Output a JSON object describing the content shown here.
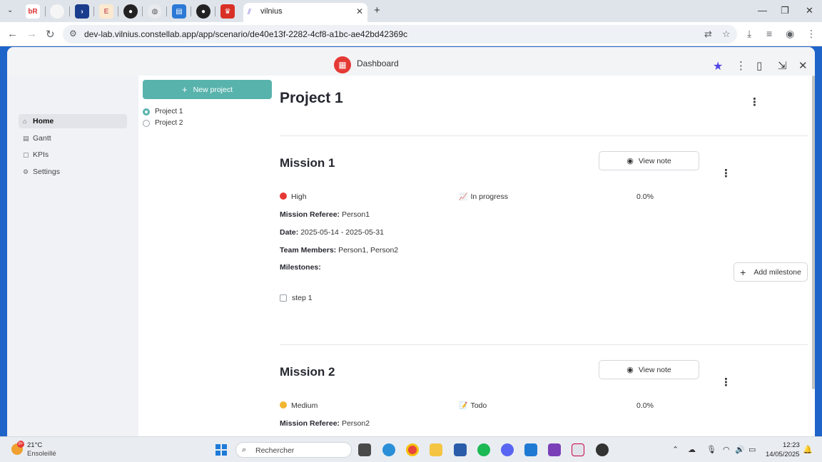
{
  "browser": {
    "active_tab_title": "vilnius",
    "url": "dev-lab.vilnius.constellab.app/app/scenario/de40e13f-2282-4cf8-a1bc-ae42bd42369c",
    "pinned_tab_labels": [
      "bR",
      "E"
    ]
  },
  "app": {
    "header_title": "Dashboard",
    "star_color": "#4f46e5"
  },
  "sidebar": {
    "items": [
      {
        "label": "Home",
        "icon": "home-icon"
      },
      {
        "label": "Gantt",
        "icon": "chart-icon"
      },
      {
        "label": "KPIs",
        "icon": "kpi-icon"
      },
      {
        "label": "Settings",
        "icon": "gear-icon"
      }
    ]
  },
  "projects": {
    "new_label": "New project",
    "options": [
      "Project 1",
      "Project 2"
    ],
    "selected": "Project 1"
  },
  "main": {
    "project_title": "Project 1",
    "missions": [
      {
        "title": "Mission 1",
        "view_note": "View note",
        "priority": "High",
        "priority_color": "#e53935",
        "status": "In progress",
        "progress": "0.0%",
        "referee_label": "Mission Referee:",
        "referee": "Person1",
        "date_label": "Date:",
        "date": "2025-05-14 - 2025-05-31",
        "team_label": "Team Members:",
        "team": "Person1, Person2",
        "milestones_label": "Milestones:",
        "add_milestone": "Add milestone",
        "milestones": [
          "step 1"
        ]
      },
      {
        "title": "Mission 2",
        "view_note": "View note",
        "priority": "Medium",
        "priority_color": "#f2b630",
        "status": "Todo",
        "progress": "0.0%",
        "referee_label": "Mission Referee:",
        "referee": "Person2"
      }
    ]
  },
  "taskbar": {
    "temp": "21°C",
    "condition": "Ensoleillé",
    "weather_badge": "9+",
    "search_label": "Rechercher",
    "time": "12:23",
    "date": "14/05/2025"
  }
}
